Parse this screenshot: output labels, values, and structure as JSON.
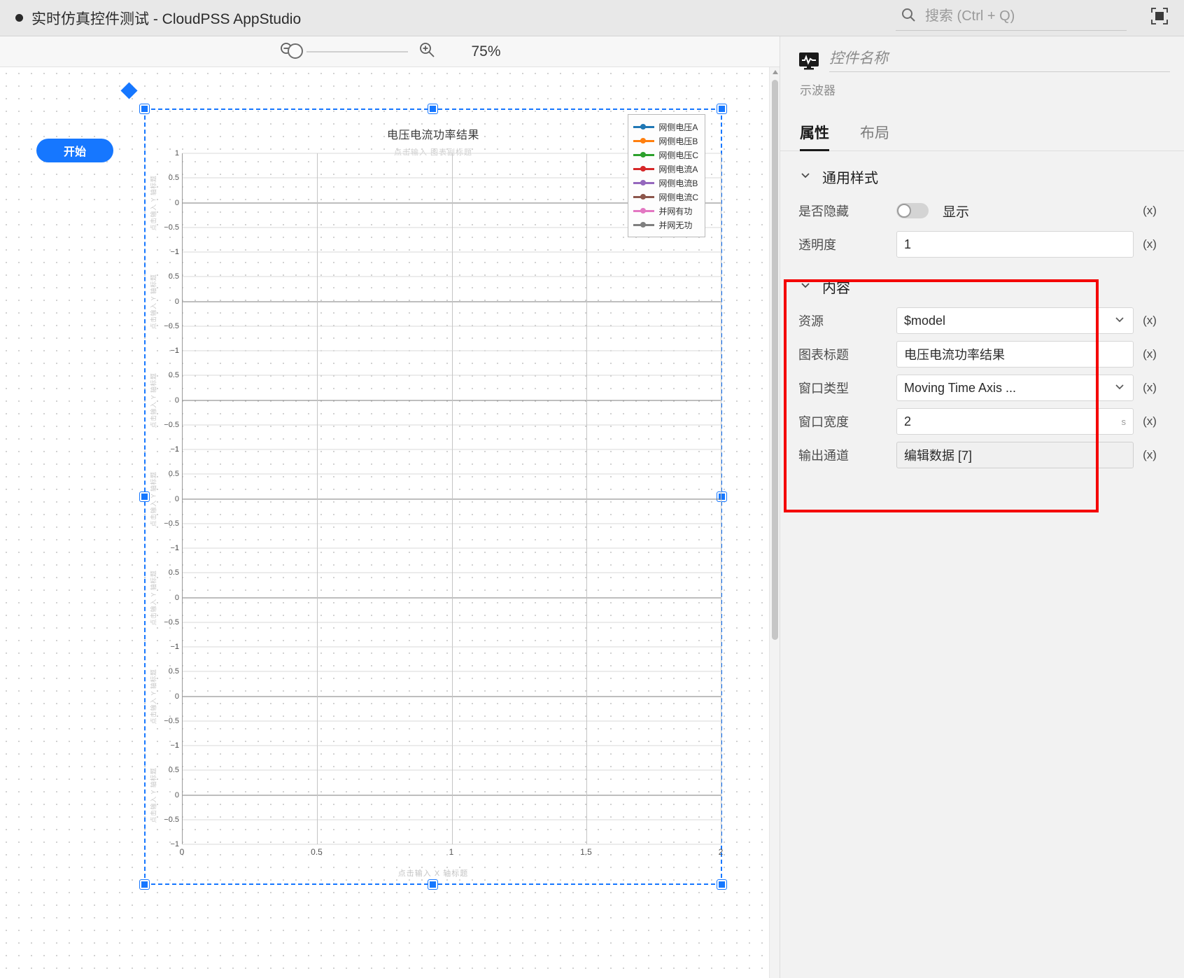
{
  "titlebar": {
    "title": "实时仿真控件测试 - CloudPSS AppStudio",
    "search_placeholder": "搜索 (Ctrl + Q)",
    "fullscreen_icon": "fullscreen-icon",
    "search_icon": "search-icon"
  },
  "toolbar": {
    "zoom_out_icon": "zoom-out-icon",
    "zoom_in_icon": "zoom-in-icon",
    "zoom_level": "75%"
  },
  "canvas": {
    "start_button": "开始"
  },
  "chart_data": {
    "type": "line",
    "title": "电压电流功率结果",
    "subtitle": "点击输入 图表副标题",
    "xlabel": "点击输入 X 轴标题",
    "ylabel": "点击输入 Y 轴标题",
    "xticks": [
      "0",
      "0.5",
      "1",
      "1.5",
      "2"
    ],
    "x": [
      0,
      0.5,
      1,
      1.5,
      2
    ],
    "xlim": [
      0,
      2
    ],
    "yticks": [
      "1",
      "0.5",
      "0",
      "-0.5",
      "-1"
    ],
    "ylim": [
      -1,
      1
    ],
    "grid": true,
    "legend_position": "top-right",
    "panel_count": 7,
    "series": [
      {
        "name": "网侧电压A",
        "color": "#1f77b4",
        "values": [
          0,
          0,
          0,
          0,
          0
        ]
      },
      {
        "name": "网侧电压B",
        "color": "#ff7f0e",
        "values": [
          0,
          0,
          0,
          0,
          0
        ]
      },
      {
        "name": "网侧电压C",
        "color": "#2ca02c",
        "values": [
          0,
          0,
          0,
          0,
          0
        ]
      },
      {
        "name": "网侧电流A",
        "color": "#d62728",
        "values": [
          0,
          0,
          0,
          0,
          0
        ]
      },
      {
        "name": "网侧电流B",
        "color": "#9467bd",
        "values": [
          0,
          0,
          0,
          0,
          0
        ]
      },
      {
        "name": "网侧电流C",
        "color": "#8c564b",
        "values": [
          0,
          0,
          0,
          0,
          0
        ]
      },
      {
        "name": "并网有功",
        "color": "#e377c2",
        "values": [
          0,
          0,
          0,
          0,
          0
        ]
      },
      {
        "name": "并网无功",
        "color": "#7f7f7f",
        "values": [
          0,
          0,
          0,
          0,
          0
        ]
      }
    ]
  },
  "panel": {
    "widget_name_placeholder": "控件名称",
    "widget_type": "示波器",
    "widget_icon": "oscilloscope-icon",
    "tabs": [
      {
        "label": "属性",
        "active": true
      },
      {
        "label": "布局",
        "active": false
      }
    ],
    "sections": [
      {
        "title": "通用样式",
        "fields": [
          {
            "label": "是否隐藏",
            "kind": "toggle",
            "value": "显示",
            "on": false,
            "expr": "(x)"
          },
          {
            "label": "透明度",
            "kind": "text",
            "value": "1",
            "expr": "(x)"
          }
        ]
      },
      {
        "title": "内容",
        "highlighted": true,
        "fields": [
          {
            "label": "资源",
            "kind": "select",
            "value": "$model",
            "expr": "(x)"
          },
          {
            "label": "图表标题",
            "kind": "text",
            "value": "电压电流功率结果",
            "expr": "(x)"
          },
          {
            "label": "窗口类型",
            "kind": "select",
            "value": "Moving Time Axis ...",
            "expr": "(x)"
          },
          {
            "label": "窗口宽度",
            "kind": "text",
            "value": "2",
            "unit": "s",
            "expr": "(x)"
          },
          {
            "label": "输出通道",
            "kind": "button",
            "value": "编辑数据 [7]",
            "expr": "(x)"
          }
        ]
      }
    ]
  }
}
